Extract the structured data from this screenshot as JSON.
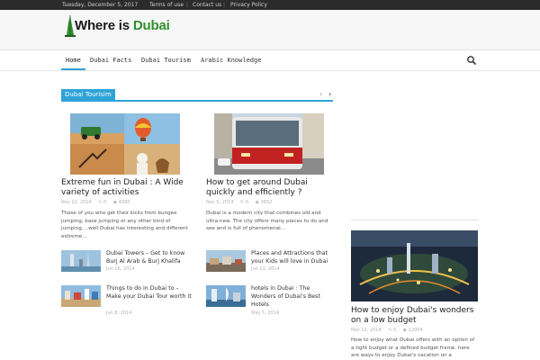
{
  "topbar": {
    "date": "Tuesday, December 5, 2017",
    "links": [
      "Terms of use",
      "Contact us",
      "Privacy Policy"
    ]
  },
  "logo": {
    "text_part1": "Where is ",
    "text_part2": "Dubai"
  },
  "nav": {
    "items": [
      "Home",
      "Dubai Facts",
      "Dubai Tourism",
      "Arabic Knowledge"
    ]
  },
  "section": {
    "title": "Dubai Tourisim",
    "prev": "‹",
    "next": "›"
  },
  "featured": [
    {
      "title": "Extreme fun in Dubai : A Wide variety of activities",
      "date": "Nov 12, 2014",
      "comments": "0",
      "views": "4085",
      "excerpt": "Those of you who get their kicks from bungee jumping, base jumping or any other kind of jumping….well Dubai has interesting and different extreme…"
    },
    {
      "title": "How to get around Dubai quickly and efficiently ?",
      "date": "Nov 5, 2014",
      "comments": "0",
      "views": "2652",
      "excerpt": "Dubai is a modern city that combines old and ultra-new. The city offers many places to do and see and is full of phenomenal…"
    }
  ],
  "small_posts_left": [
    {
      "title": "Dubai Towers – Get to know Burj Al Arab & Burj Khalifa",
      "date": "Jun 16, 2014"
    },
    {
      "title": "Things to do in Dubai to – Make your Dubai Tour worth it",
      "date": "Jun 8, 2014"
    }
  ],
  "small_posts_right": [
    {
      "title": "Places and Attractions that your Kids will love in Dubai",
      "date": "Jun 11, 2014"
    },
    {
      "title": "hotels in Dubai : The Wonders of Dubai's Best Hotels",
      "date": "May 5, 2014"
    }
  ],
  "sidebar_post": {
    "title": "How to enjoy Dubai's wonders on a low budget",
    "date": "Nov 12, 2014",
    "comments": "0",
    "views": "12004",
    "excerpt": "How to enjoy what Dubai offers with an option of a tight budget or a defined budget frame. here are ways to enjoy Dubai's vacation on a"
  },
  "colors": {
    "accent": "#2ea3d8",
    "topbar": "#2b2b2b"
  }
}
